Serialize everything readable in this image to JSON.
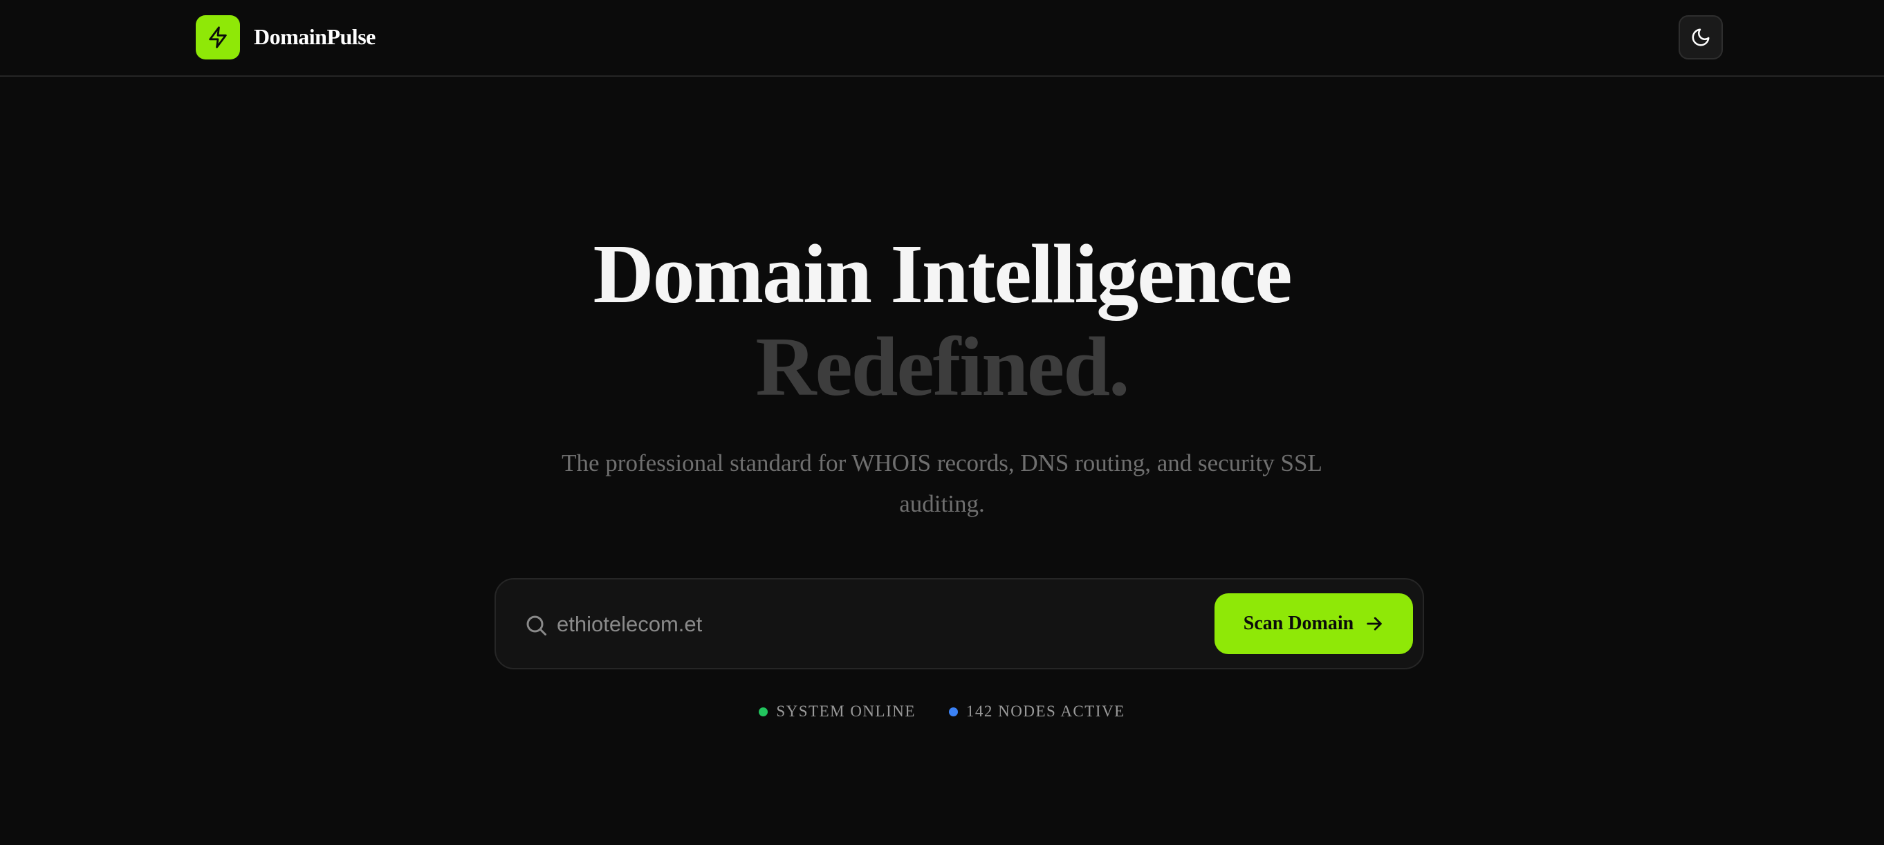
{
  "header": {
    "brand": "DomainPulse",
    "logo_icon": "lightning-bolt-icon",
    "theme_toggle_icon": "moon-icon"
  },
  "hero": {
    "title_line1": "Domain Intelligence",
    "title_line2": "Redefined.",
    "subtitle": "The professional standard for WHOIS records, DNS routing, and security SSL auditing."
  },
  "search": {
    "value": "ethiotelecom.et",
    "icon": "search-icon",
    "button_label": "Scan Domain",
    "button_icon": "arrow-right-icon"
  },
  "status": [
    {
      "label": "SYSTEM ONLINE",
      "color": "#22c55e"
    },
    {
      "label": "142 NODES ACTIVE",
      "color": "#3b82f6"
    }
  ],
  "colors": {
    "accent": "#8fe807",
    "background": "#0b0b0b"
  }
}
